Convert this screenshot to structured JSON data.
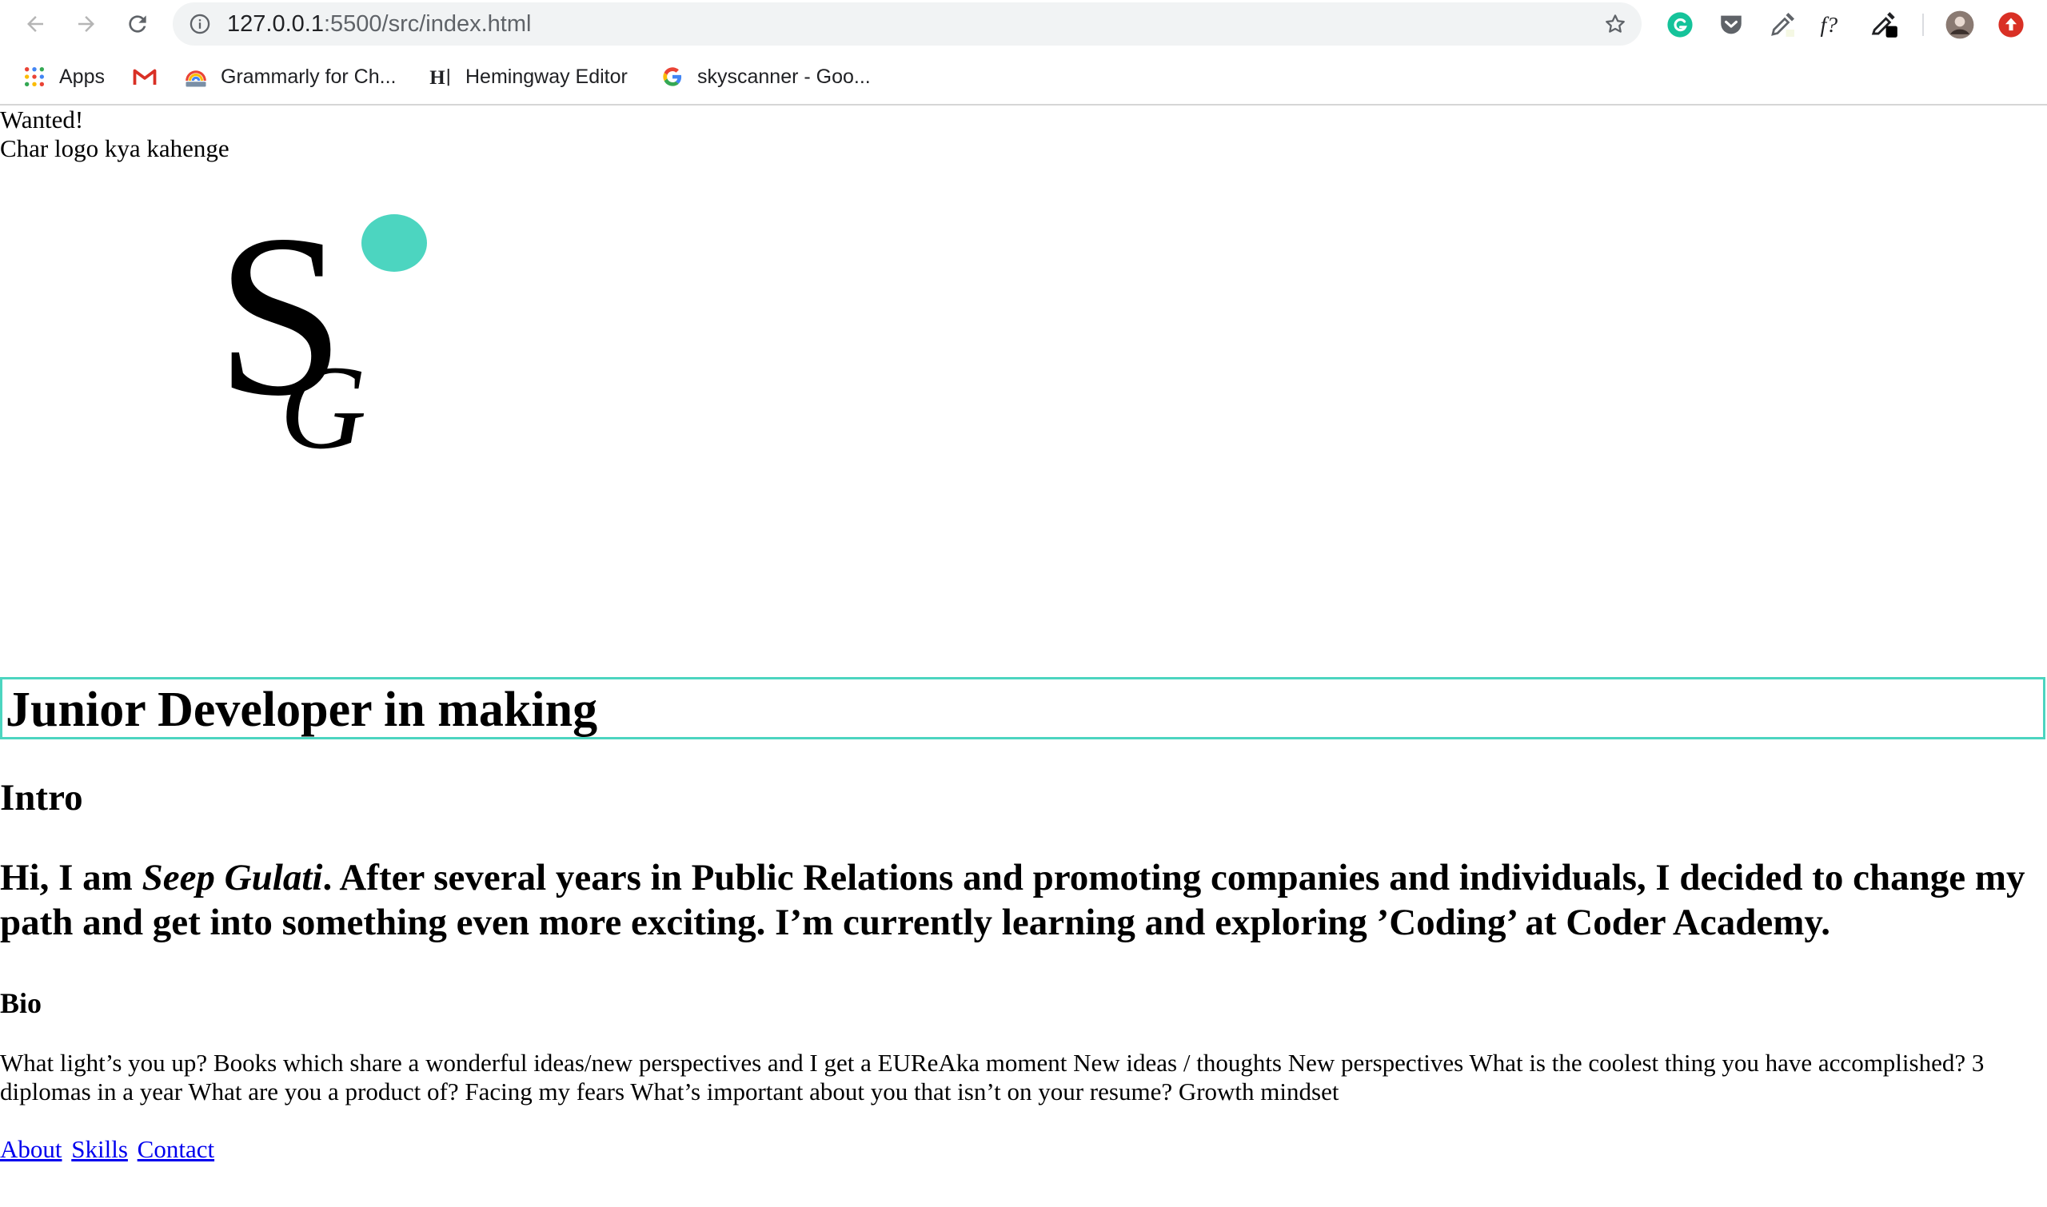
{
  "browser": {
    "url_host": "127.0.0.1",
    "url_path": ":5500/src/index.html",
    "bookmarks": [
      {
        "label": "Apps",
        "icon": "apps-grid-icon"
      },
      {
        "label": "",
        "icon": "gmail-icon"
      },
      {
        "label": "Grammarly for Ch...",
        "icon": "grammarly-rainbow-icon"
      },
      {
        "label": "Hemingway Editor",
        "icon": "hemingway-h-icon"
      },
      {
        "label": "skyscanner - Goo...",
        "icon": "google-g-icon"
      }
    ],
    "extensions": [
      "grammarly-icon",
      "pocket-icon",
      "eyedropper-icon",
      "font-finder-icon",
      "color-picker-icon",
      "profile-avatar-icon",
      "update-icon"
    ]
  },
  "page": {
    "top_line1": "Wanted!",
    "top_line2": "Char logo kya kahenge",
    "logo": {
      "letters": "SG",
      "accent_color": "#4cd5c0"
    },
    "headline": "Junior Developer in making",
    "intro_heading": "Intro",
    "intro": {
      "before": "Hi, I am ",
      "name": "Seep Gulati",
      "after": ". After several years in Public Relations and promoting companies and individuals, I decided to change my path and get into something even more exciting. I’m currently learning and exploring ’Coding’ at Coder Academy."
    },
    "bio_heading": "Bio",
    "bio": "What light’s you up? Books which share a wonderful ideas/new perspectives and I get a EUReAka moment New ideas / thoughts New perspectives What is the coolest thing you have accomplished? 3 diplomas in a year What are you a product of? Facing my fears What’s important about you that isn’t on your resume? Growth mindset",
    "nav": [
      "About",
      "Skills",
      "Contact"
    ]
  }
}
